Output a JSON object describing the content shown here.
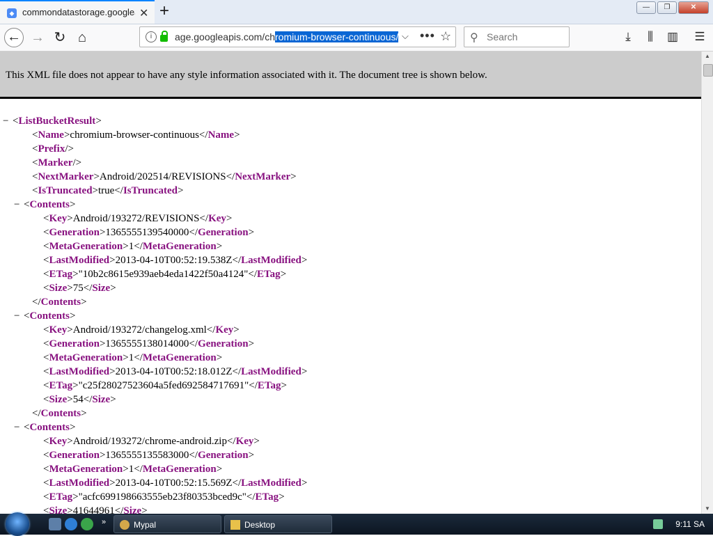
{
  "tab": {
    "title": "commondatastorage.googleapis.com/chromium-browser-continuous/",
    "close": "✕"
  },
  "newtab": "+",
  "window_buttons": {
    "minimize": "—",
    "maximize": "❐",
    "close": "✕"
  },
  "nav": {
    "back": "←",
    "forward": "→",
    "reload": "↻",
    "home": "⌂"
  },
  "url": {
    "prefix": "age.googleapis.com/ch",
    "selected": "romium-browser-continuous/"
  },
  "search": {
    "placeholder": "Search"
  },
  "xml_notice": "This XML file does not appear to have any style information associated with it. The document tree is shown below.",
  "xml_lines": [
    {
      "d": 0,
      "t": "−",
      "p": [
        "<",
        "ListBucketResult",
        ">"
      ]
    },
    {
      "d": 2,
      "t": "",
      "p": [
        "<",
        "Name",
        ">chromium-browser-continuous</",
        "Name",
        ">"
      ]
    },
    {
      "d": 2,
      "t": "",
      "p": [
        "<",
        "Prefix",
        "/>"
      ]
    },
    {
      "d": 2,
      "t": "",
      "p": [
        "<",
        "Marker",
        "/>"
      ]
    },
    {
      "d": 2,
      "t": "",
      "p": [
        "<",
        "NextMarker",
        ">Android/202514/REVISIONS</",
        "NextMarker",
        ">"
      ]
    },
    {
      "d": 2,
      "t": "",
      "p": [
        "<",
        "IsTruncated",
        ">true</",
        "IsTruncated",
        ">"
      ]
    },
    {
      "d": 1,
      "t": "−",
      "p": [
        "<",
        "Contents",
        ">"
      ]
    },
    {
      "d": 3,
      "t": "",
      "p": [
        "<",
        "Key",
        ">Android/193272/REVISIONS</",
        "Key",
        ">"
      ]
    },
    {
      "d": 3,
      "t": "",
      "p": [
        "<",
        "Generation",
        ">1365555139540000</",
        "Generation",
        ">"
      ]
    },
    {
      "d": 3,
      "t": "",
      "p": [
        "<",
        "MetaGeneration",
        ">1</",
        "MetaGeneration",
        ">"
      ]
    },
    {
      "d": 3,
      "t": "",
      "p": [
        "<",
        "LastModified",
        ">2013-04-10T00:52:19.538Z</",
        "LastModified",
        ">"
      ]
    },
    {
      "d": 3,
      "t": "",
      "p": [
        "<",
        "ETag",
        ">\"10b2c8615e939aeb4eda1422f50a4124\"</",
        "ETag",
        ">"
      ]
    },
    {
      "d": 3,
      "t": "",
      "p": [
        "<",
        "Size",
        ">75</",
        "Size",
        ">"
      ]
    },
    {
      "d": 2,
      "t": "",
      "p": [
        "</",
        "Contents",
        ">"
      ]
    },
    {
      "d": 1,
      "t": "−",
      "p": [
        "<",
        "Contents",
        ">"
      ]
    },
    {
      "d": 3,
      "t": "",
      "p": [
        "<",
        "Key",
        ">Android/193272/changelog.xml</",
        "Key",
        ">"
      ]
    },
    {
      "d": 3,
      "t": "",
      "p": [
        "<",
        "Generation",
        ">1365555138014000</",
        "Generation",
        ">"
      ]
    },
    {
      "d": 3,
      "t": "",
      "p": [
        "<",
        "MetaGeneration",
        ">1</",
        "MetaGeneration",
        ">"
      ]
    },
    {
      "d": 3,
      "t": "",
      "p": [
        "<",
        "LastModified",
        ">2013-04-10T00:52:18.012Z</",
        "LastModified",
        ">"
      ]
    },
    {
      "d": 3,
      "t": "",
      "p": [
        "<",
        "ETag",
        ">\"c25f28027523604a5fed692584717691\"</",
        "ETag",
        ">"
      ]
    },
    {
      "d": 3,
      "t": "",
      "p": [
        "<",
        "Size",
        ">54</",
        "Size",
        ">"
      ]
    },
    {
      "d": 2,
      "t": "",
      "p": [
        "</",
        "Contents",
        ">"
      ]
    },
    {
      "d": 1,
      "t": "−",
      "p": [
        "<",
        "Contents",
        ">"
      ]
    },
    {
      "d": 3,
      "t": "",
      "p": [
        "<",
        "Key",
        ">Android/193272/chrome-android.zip</",
        "Key",
        ">"
      ]
    },
    {
      "d": 3,
      "t": "",
      "p": [
        "<",
        "Generation",
        ">1365555135583000</",
        "Generation",
        ">"
      ]
    },
    {
      "d": 3,
      "t": "",
      "p": [
        "<",
        "MetaGeneration",
        ">1</",
        "MetaGeneration",
        ">"
      ]
    },
    {
      "d": 3,
      "t": "",
      "p": [
        "<",
        "LastModified",
        ">2013-04-10T00:52:15.569Z</",
        "LastModified",
        ">"
      ]
    },
    {
      "d": 3,
      "t": "",
      "p": [
        "<",
        "ETag",
        ">\"acfc699198663555eb23f80353bced9c\"</",
        "ETag",
        ">"
      ]
    },
    {
      "d": 3,
      "t": "",
      "p": [
        "<",
        "Size",
        ">41644961</",
        "Size",
        ">"
      ]
    }
  ],
  "taskbar": {
    "items": [
      {
        "label": "Mypal"
      },
      {
        "label": "Desktop"
      }
    ],
    "clock": "9:11 SA"
  }
}
